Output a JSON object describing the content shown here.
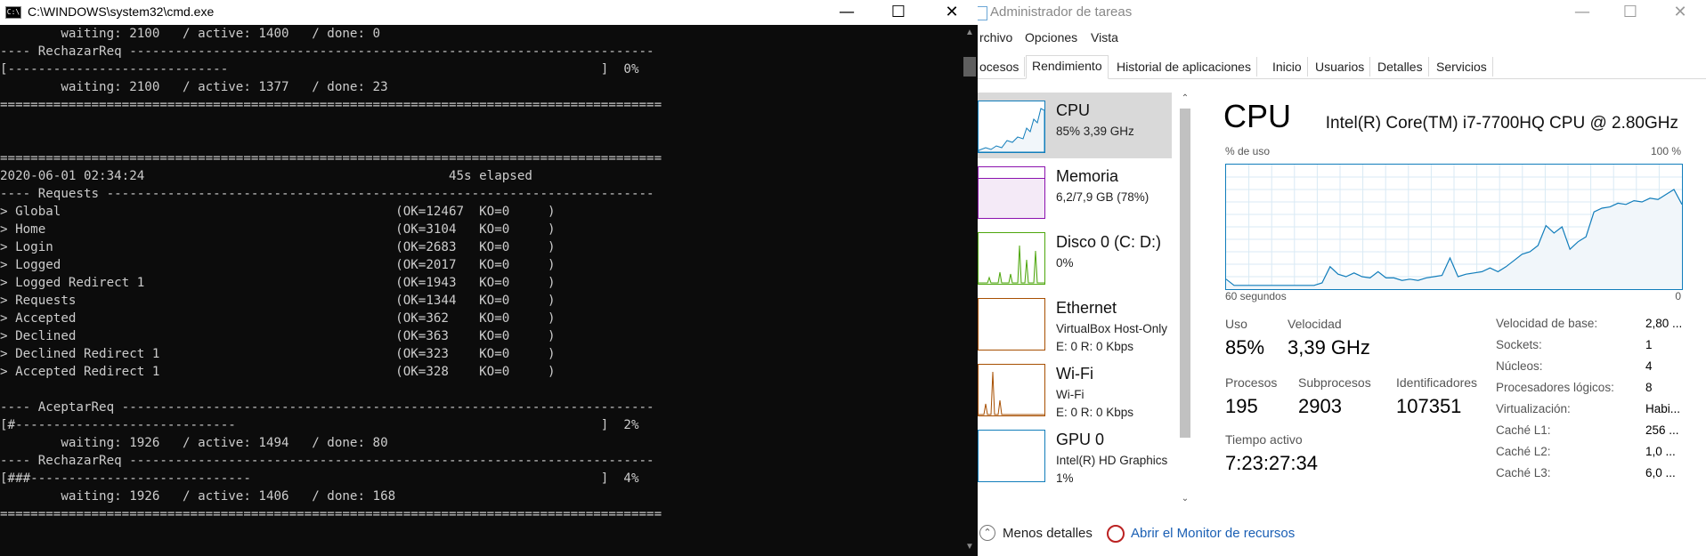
{
  "cmd": {
    "title": "C:\\WINDOWS\\system32\\cmd.exe",
    "title_icon": "C:\\",
    "controls": {
      "minimize": "—",
      "maximize": "☐",
      "close": "✕"
    },
    "lines": [
      "        waiting: 2100   / active: 1400   / done: 0",
      "---- RechazarReq ---------------------------------------------------------------------",
      "[-----------------------------                                                 ]  0%",
      "        waiting: 2100   / active: 1377   / done: 23",
      "=======================================================================================",
      "",
      "",
      "=======================================================================================",
      "2020-06-01 02:34:24                                        45s elapsed",
      "---- Requests ------------------------------------------------------------------------",
      "> Global                                            (OK=12467  KO=0     )",
      "> Home                                              (OK=3104   KO=0     )",
      "> Login                                             (OK=2683   KO=0     )",
      "> Logged                                            (OK=2017   KO=0     )",
      "> Logged Redirect 1                                 (OK=1943   KO=0     )",
      "> Requests                                          (OK=1344   KO=0     )",
      "> Accepted                                          (OK=362    KO=0     )",
      "> Declined                                          (OK=363    KO=0     )",
      "> Declined Redirect 1                               (OK=323    KO=0     )",
      "> Accepted Redirect 1                               (OK=328    KO=0     )",
      "",
      "---- AceptarReq ----------------------------------------------------------------------",
      "[#-----------------------------                                                ]  2%",
      "        waiting: 1926   / active: 1494   / done: 80",
      "---- RechazarReq ---------------------------------------------------------------------",
      "[###-----------------------------                                              ]  4%",
      "        waiting: 1926   / active: 1406   / done: 168",
      "======================================================================================="
    ]
  },
  "taskmgr": {
    "title": "Administrador de tareas",
    "controls": {
      "minimize": "—",
      "maximize": "☐",
      "close": "✕"
    },
    "menu": [
      "rchivo",
      "Opciones",
      "Vista"
    ],
    "tabs": [
      "ocesos",
      "Rendimiento",
      "Historial de aplicaciones",
      "Inicio",
      "Usuarios",
      "Detalles",
      "Servicios"
    ],
    "active_tab": "Rendimiento",
    "items": [
      {
        "name": "CPU",
        "sub": "85% 3,39 GHz",
        "sub2": "",
        "color": "#117dbb"
      },
      {
        "name": "Memoria",
        "sub": "6,2/7,9 GB (78%)",
        "sub2": "",
        "color": "#8b12ae"
      },
      {
        "name": "Disco 0 (C: D:)",
        "sub": "0%",
        "sub2": "",
        "color": "#4da60c"
      },
      {
        "name": "Ethernet",
        "sub": "VirtualBox Host-Only",
        "sub2": "E: 0 R: 0 Kbps",
        "color": "#a74f01"
      },
      {
        "name": "Wi-Fi",
        "sub": "Wi-Fi",
        "sub2": "E: 0 R: 0 Kbps",
        "color": "#a74f01"
      },
      {
        "name": "GPU 0",
        "sub": "Intel(R) HD Graphics",
        "sub2": "1%",
        "color": "#117dbb"
      }
    ],
    "detail": {
      "title": "CPU",
      "model": "Intel(R) Core(TM) i7-7700HQ CPU @ 2.80GHz",
      "graph_label_top_left": "% de uso",
      "graph_label_top_right": "100 %",
      "graph_label_bottom_left": "60 segundos",
      "graph_label_bottom_right": "0",
      "usage_history_pct": [
        8,
        3,
        3,
        3,
        3,
        3,
        3,
        3,
        3,
        3,
        3,
        3,
        5,
        18,
        12,
        10,
        13,
        10,
        9,
        14,
        9,
        9,
        7,
        8,
        7,
        9,
        10,
        11,
        25,
        10,
        12,
        13,
        14,
        17,
        14,
        18,
        23,
        28,
        30,
        35,
        51,
        45,
        50,
        32,
        38,
        42,
        62,
        65,
        66,
        69,
        68,
        71,
        70,
        73,
        72,
        76,
        80,
        68
      ],
      "uso_label": "Uso",
      "uso": "85%",
      "velocidad_label": "Velocidad",
      "velocidad": "3,39 GHz",
      "procesos_label": "Procesos",
      "procesos": "195",
      "subprocesos_label": "Subprocesos",
      "subprocesos": "2903",
      "identificadores_label": "Identificadores",
      "identificadores": "107351",
      "tiempo_label": "Tiempo activo",
      "tiempo": "7:23:27:34",
      "specs": [
        {
          "label": "Velocidad de base:",
          "value": "2,80 ..."
        },
        {
          "label": "Sockets:",
          "value": "1"
        },
        {
          "label": "Núcleos:",
          "value": "4"
        },
        {
          "label": "Procesadores lógicos:",
          "value": "8"
        },
        {
          "label": "Virtualización:",
          "value": "Habi..."
        },
        {
          "label": "Caché L1:",
          "value": "256 ..."
        },
        {
          "label": "Caché L2:",
          "value": "1,0 ..."
        },
        {
          "label": "Caché L3:",
          "value": "6,0 ..."
        }
      ]
    },
    "bottom": {
      "fewer_details": "Menos detalles",
      "resource_monitor": "Abrir el Monitor de recursos"
    }
  }
}
